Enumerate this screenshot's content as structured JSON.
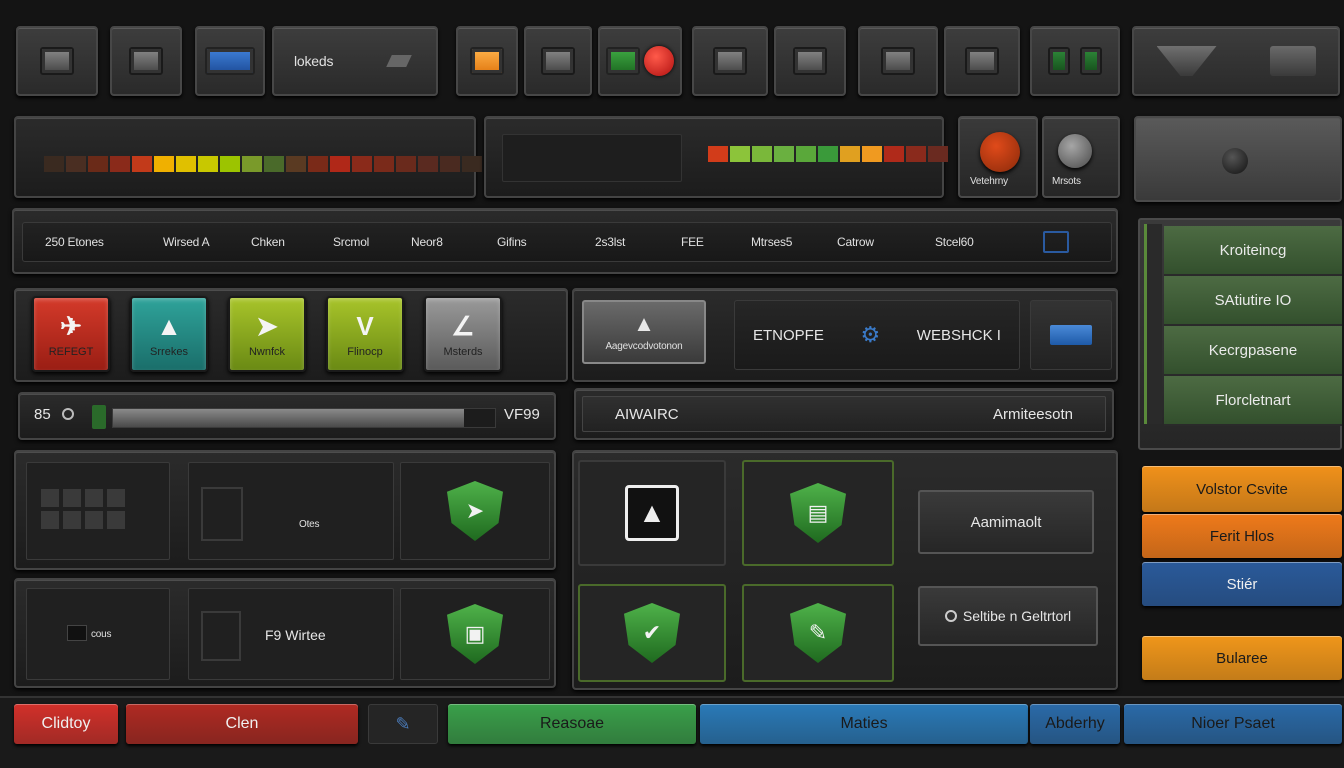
{
  "toolbar": {
    "btn_label_1": "lokeds"
  },
  "meters": {
    "left_segments": [
      "#3a2a20",
      "#4a2e22",
      "#6a2a18",
      "#8a2a1a",
      "#c23a1a",
      "#f0b000",
      "#e0c000",
      "#c8c800",
      "#9cc400",
      "#7a9a2a",
      "#4a6a2a",
      "#5a3a22",
      "#7a2a18",
      "#b02818",
      "#8a2a1a",
      "#7a2a1a",
      "#6a2a1c",
      "#5a2a20",
      "#4a2a20",
      "#3a2a20"
    ],
    "center_segments": [
      "#d23c1a",
      "#8cc43a",
      "#7ab83a",
      "#6ab040",
      "#5aa83a",
      "#3a9a3a",
      "#e0a020",
      "#f09a20",
      "#b02a1a",
      "#8a2a1c",
      "#6a2a20"
    ]
  },
  "status_panel": {
    "knob_left_label": "Vetehrny",
    "knob_right_label": "Mrsots",
    "knob_left_color": "#e04a1a",
    "knob_right_color": "#a6a6a6"
  },
  "tabs": {
    "items": [
      "250 Etones",
      "Wirsed A",
      "Chken",
      "Srcmol",
      "Neor8",
      "Gifins",
      "2s3lst",
      "FEE",
      "Mtrses5",
      "Catrow",
      "Stcel60"
    ]
  },
  "tiles": [
    {
      "label": "REFEGT",
      "color_top": "#d43a2a",
      "color_bottom": "#9a1e14",
      "glyph": "✈"
    },
    {
      "label": "Srrekes",
      "color_top": "#2fa39a",
      "color_bottom": "#1a6e6a",
      "glyph": "▲"
    },
    {
      "label": "Nwnfck",
      "color_top": "#a8c42a",
      "color_bottom": "#6a8a14",
      "glyph": "➤"
    },
    {
      "label": "Flinocp",
      "color_top": "#a8c42a",
      "color_bottom": "#6a8a14",
      "glyph": "V"
    },
    {
      "label": "Msterds",
      "color_top": "#9a9a9a",
      "color_bottom": "#5a5a5a",
      "glyph": "∠"
    }
  ],
  "center_top": {
    "media_label": "Aagevcodvotonon",
    "field_label_left": "ETNOPFE",
    "field_label_right": "WEBSHCK I"
  },
  "progress": {
    "left_label": "85",
    "right_label": "VF99",
    "fraction": 0.92
  },
  "aware_bar": {
    "left": "AIWAIRC",
    "right": "Armiteesotn"
  },
  "grid_left": {
    "row1_label": "Otes",
    "row2_left": "cous",
    "row2_mid": "F9 Wirtee"
  },
  "center_actions": {
    "button1": "Aamimaolt",
    "button2": "Seltibe n Geltrtorl"
  },
  "sidebar": {
    "items": [
      "Kroiteincg",
      "SAtiutire IO",
      "Kecrgpasene",
      "Florcletnart"
    ]
  },
  "right_buttons": [
    {
      "label": "Volstor Csvite",
      "color": "#f0911a"
    },
    {
      "label": "Ferit Hlos",
      "color": "#ef7a1a"
    },
    {
      "label": "Stiér",
      "color": "#2a5a9a"
    },
    {
      "label": "Bularee",
      "color": "#f0961a"
    }
  ],
  "bottom_bar": {
    "items": [
      {
        "label": "Clidtoy",
        "color": "#d2302a"
      },
      {
        "label": "Clen",
        "color": "#b02a22"
      },
      {
        "label": "Reasoae",
        "color": "#3aa04a"
      },
      {
        "label": "Maties",
        "color": "#2a7ab8"
      },
      {
        "label": "Abderhy",
        "color": "#2a6aa8"
      },
      {
        "label": "Nioer Psaet",
        "color": "#2a6aa8"
      }
    ]
  }
}
